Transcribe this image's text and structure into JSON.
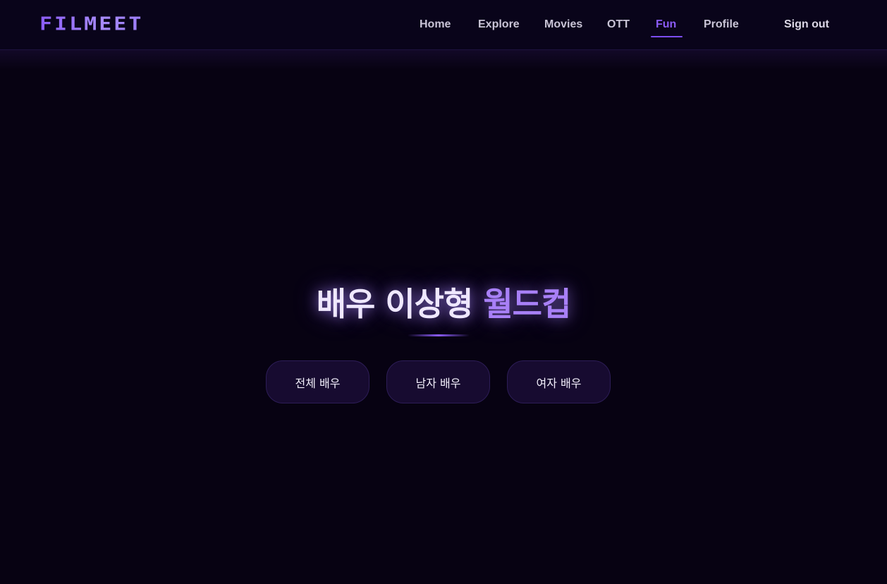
{
  "header": {
    "logo": "FILMEET",
    "nav": [
      {
        "label": "Home",
        "active": false
      },
      {
        "label": "Explore",
        "active": false
      },
      {
        "label": "Movies",
        "active": false
      },
      {
        "label": "OTT",
        "active": false
      },
      {
        "label": "Fun",
        "active": true
      },
      {
        "label": "Profile",
        "active": false
      }
    ],
    "signout_label": "Sign out"
  },
  "hero": {
    "title_part1": "배우 이상형",
    "title_part2": "월드컵"
  },
  "choices": [
    {
      "label": "전체 배우"
    },
    {
      "label": "남자 배우"
    },
    {
      "label": "여자 배우"
    }
  ],
  "colors": {
    "background": "#070212",
    "accent": "#8b5cf6",
    "button_bg": "#170b30"
  }
}
